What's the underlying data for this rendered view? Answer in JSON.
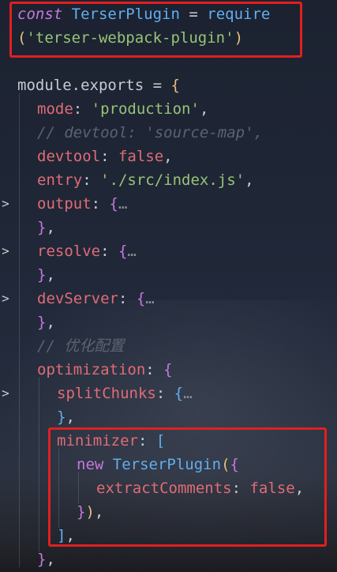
{
  "colors": {
    "highlight_border": "#e02020",
    "keyword": "#c678dd",
    "type": "#61afef",
    "string": "#98c379",
    "property": "#e06c75",
    "comment": "#5c6370",
    "bracket_level1": "#e5c07b"
  },
  "icons": {
    "fold": "chevron-right-icon",
    "ellipsis": "…"
  },
  "code": {
    "l1_const": "const",
    "l1_name": "TerserPlugin",
    "l1_eq": " = ",
    "l1_require": "require",
    "l2_open": "(",
    "l2_str": "'terser-webpack-plugin'",
    "l2_close": ")",
    "l3_module": "module.exports = ",
    "l3_brace": "{",
    "mode_key": "mode",
    "mode_val": "'production'",
    "comment_devtool": "// devtool: 'source-map',",
    "devtool_key": "devtool",
    "devtool_val": "false",
    "entry_key": "entry",
    "entry_val": "'./src/index.js'",
    "output_key": "output",
    "resolve_key": "resolve",
    "devserver_key": "devServer",
    "comment_opt": "// 优化配置",
    "optimization_key": "optimization",
    "splitchunks_key": "splitChunks",
    "minimizer_key": "minimizer",
    "new_kw": "new",
    "terser_call": "TerserPlugin",
    "extract_key": "extractComments",
    "extract_val": "false"
  }
}
